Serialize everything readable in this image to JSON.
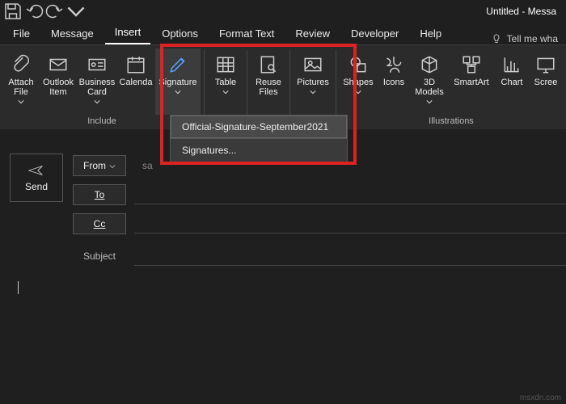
{
  "title": "Untitled  -  Messa",
  "tabs": {
    "file": "File",
    "message": "Message",
    "insert": "Insert",
    "options": "Options",
    "format": "Format Text",
    "review": "Review",
    "developer": "Developer",
    "help": "Help",
    "tellme": "Tell me wha"
  },
  "ribbon": {
    "include": {
      "label": "Include",
      "attach_file": "Attach\nFile",
      "outlook_item": "Outlook\nItem",
      "business_card": "Business\nCard",
      "calendar": "Calenda",
      "signature": "Signature"
    },
    "tables": {
      "table": "Table"
    },
    "reuse": {
      "reuse_files": "Reuse\nFiles"
    },
    "pictures": "Pictures",
    "illustrations": {
      "label": "Illustrations",
      "shapes": "Shapes",
      "icons": "Icons",
      "models": "3D\nModels",
      "smartart": "SmartArt",
      "chart": "Chart",
      "screenshot": "Scree"
    }
  },
  "signature_menu": {
    "item1": "Official-Signature-September2021",
    "item2": "Signatures..."
  },
  "compose": {
    "send": "Send",
    "from": "From",
    "to": "To",
    "cc": "Cc",
    "subject_label": "Subject",
    "saved_hint": "sa"
  },
  "footer": "msxdn.com"
}
